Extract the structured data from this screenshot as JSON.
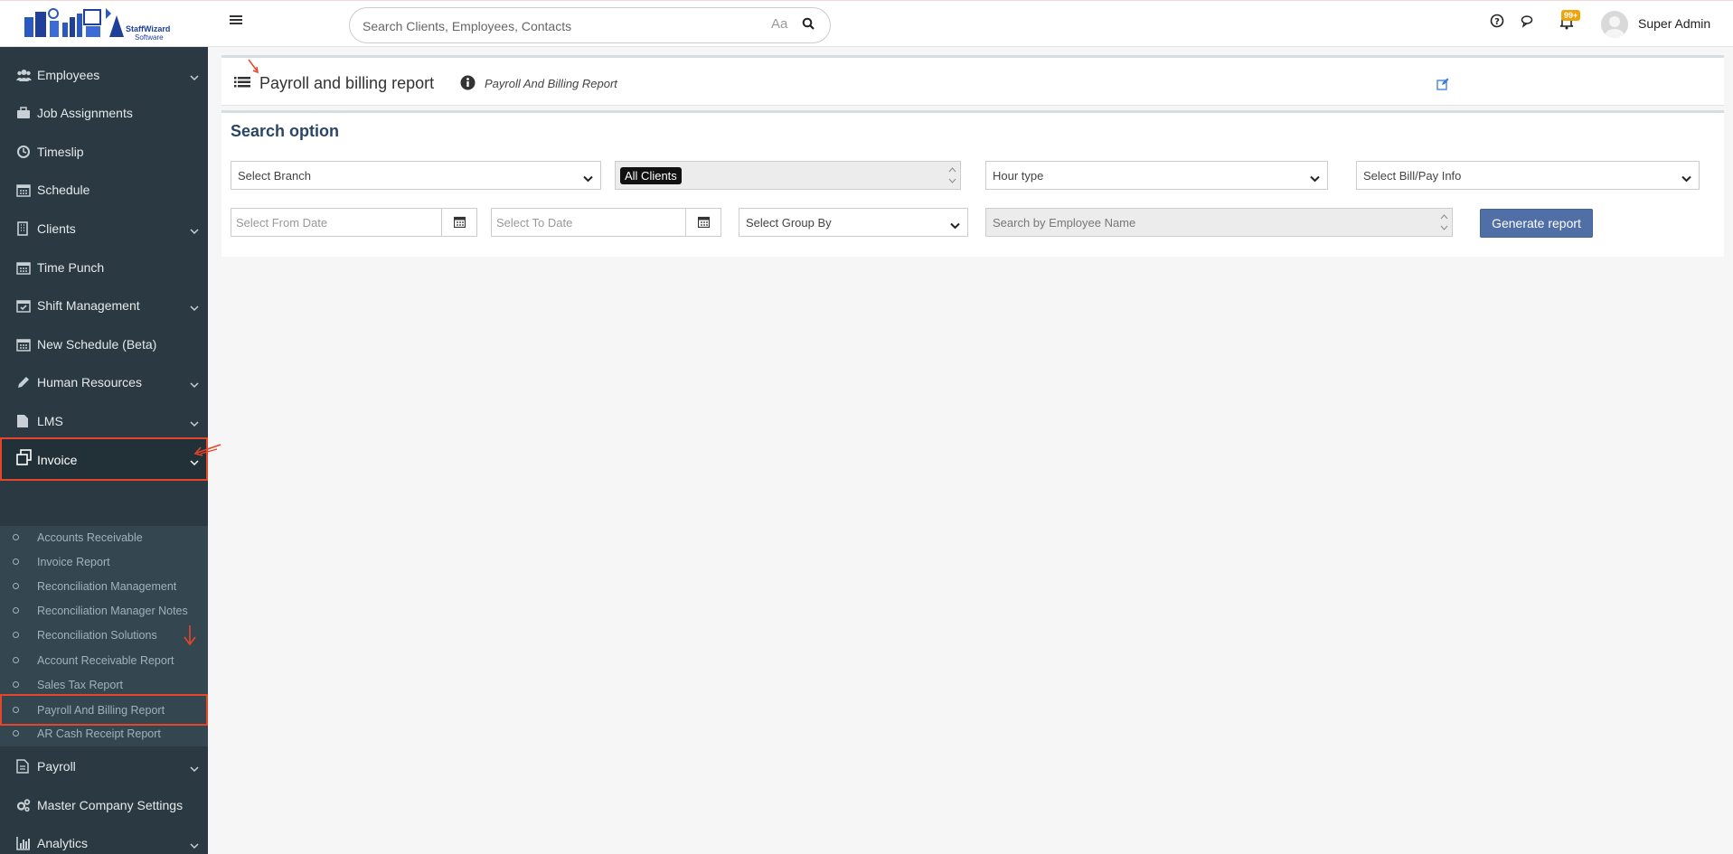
{
  "header": {
    "search_placeholder": "Search Clients, Employees, Contacts",
    "case_toggle": "Aa",
    "notification_count": "99+",
    "user_name": "Super Admin",
    "logo_text_line1": "StaffWizard",
    "logo_text_line2": "Software"
  },
  "sidebar": {
    "items": [
      {
        "label": "Employees",
        "icon": "users-icon",
        "expandable": true
      },
      {
        "label": "Job Assignments",
        "icon": "briefcase-icon",
        "expandable": false
      },
      {
        "label": "Timeslip",
        "icon": "clock-icon",
        "expandable": false
      },
      {
        "label": "Schedule",
        "icon": "calendar-icon",
        "expandable": false
      },
      {
        "label": "Clients",
        "icon": "building-icon",
        "expandable": true
      },
      {
        "label": "Time Punch",
        "icon": "calendar-icon",
        "expandable": false
      },
      {
        "label": "Shift Management",
        "icon": "calendar-check-icon",
        "expandable": true
      },
      {
        "label": "New Schedule (Beta)",
        "icon": "calendar-icon",
        "expandable": false
      },
      {
        "label": "Human Resources",
        "icon": "pencil-icon",
        "expandable": true
      },
      {
        "label": "LMS",
        "icon": "file-icon",
        "expandable": true
      },
      {
        "label": "Invoice",
        "icon": "copy-icon",
        "expandable": true
      },
      {
        "label": "Payroll",
        "icon": "document-icon",
        "expandable": true
      },
      {
        "label": "Master Company Settings",
        "icon": "cogs-icon",
        "expandable": false
      },
      {
        "label": "Analytics",
        "icon": "bar-chart-icon",
        "expandable": true
      }
    ],
    "invoice_submenu": [
      "Accounts Receivable",
      "Invoice Report",
      "Reconciliation Management",
      "Reconciliation Manager Notes",
      "Reconciliation Solutions",
      "Account Receivable Report",
      "Sales Tax Report",
      "Payroll And Billing Report",
      "AR Cash Receipt Report"
    ],
    "active_item": "Invoice",
    "active_subitem": "Payroll And Billing Report"
  },
  "page": {
    "title": "Payroll and billing report",
    "breadcrumb": "Payroll And Billing Report"
  },
  "search_options": {
    "title": "Search option",
    "branch_select": "Select Branch",
    "clients_tag": "All Clients",
    "hour_type_select": "Hour type",
    "bill_pay_select": "Select Bill/Pay Info",
    "from_date_placeholder": "Select From Date",
    "to_date_placeholder": "Select To Date",
    "group_by_select": "Select Group By",
    "employee_placeholder": "Search by Employee Name",
    "generate_button": "Generate report"
  },
  "colors": {
    "sidebar_bg": "#2b3a42",
    "submenu_bg": "#34464f",
    "highlight_border": "#e7452a",
    "primary_button": "#4f6fa6",
    "section_title": "#2b4566",
    "badge": "#f0a30a"
  }
}
